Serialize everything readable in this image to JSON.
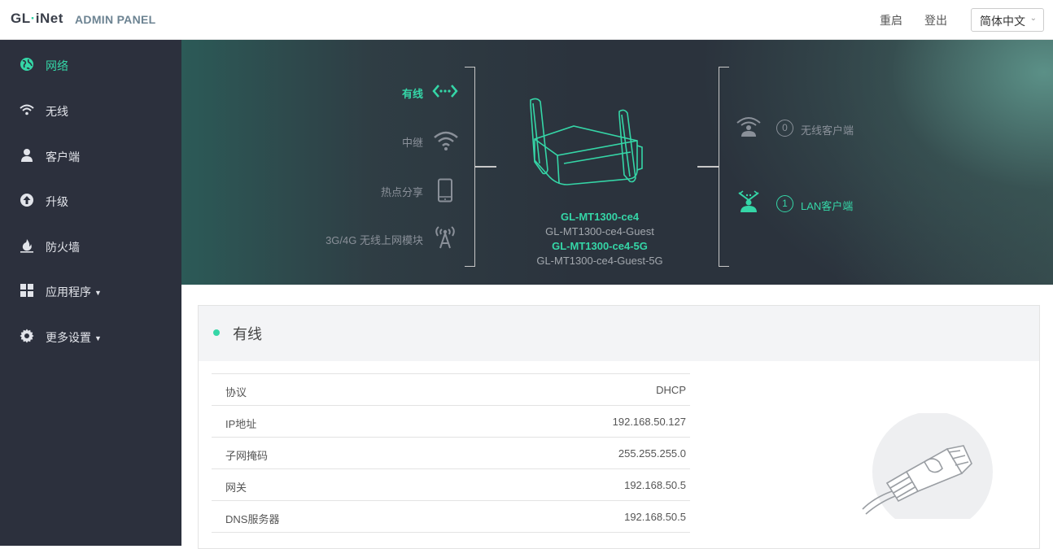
{
  "header": {
    "logo": {
      "part1": "GL",
      "dot": "·",
      "part2": "iNet"
    },
    "panel_title": "ADMIN PANEL",
    "reboot": "重启",
    "logout": "登出",
    "language": "简体中文"
  },
  "sidebar": {
    "items": [
      {
        "label": "网络",
        "icon": "globe-icon",
        "active": true
      },
      {
        "label": "无线",
        "icon": "wifi-icon"
      },
      {
        "label": "客户端",
        "icon": "user-icon"
      },
      {
        "label": "升级",
        "icon": "upgrade-icon"
      },
      {
        "label": "防火墙",
        "icon": "fire-icon"
      },
      {
        "label": "应用程序",
        "icon": "apps-grid-icon",
        "has_dropdown": true
      },
      {
        "label": "更多设置",
        "icon": "gear-icon",
        "has_dropdown": true
      }
    ]
  },
  "hero": {
    "connections": [
      {
        "label": "有线",
        "icon": "ethernet-arrows-icon",
        "active": true
      },
      {
        "label": "中继",
        "icon": "wifi-repeater-icon"
      },
      {
        "label": "热点分享",
        "icon": "phone-tethering-icon"
      },
      {
        "label": "3G/4G 无线上网模块",
        "icon": "cellular-tower-icon"
      }
    ],
    "ssids": [
      {
        "name": "GL-MT1300-ce4",
        "bright": true
      },
      {
        "name": "GL-MT1300-ce4-Guest",
        "bright": false
      },
      {
        "name": "GL-MT1300-ce4-5G",
        "bright": true
      },
      {
        "name": "GL-MT1300-ce4-Guest-5G",
        "bright": false
      }
    ],
    "clients": [
      {
        "count": "0",
        "label": "无线客户端",
        "icon": "wireless-client-icon",
        "active": false
      },
      {
        "count": "1",
        "label": "LAN客户端",
        "icon": "lan-client-icon",
        "active": true
      }
    ]
  },
  "card": {
    "title": "有线",
    "rows": [
      {
        "key": "协议",
        "value": "DHCP"
      },
      {
        "key": "IP地址",
        "value": "192.168.50.127"
      },
      {
        "key": "子网掩码",
        "value": "255.255.255.0"
      },
      {
        "key": "网关",
        "value": "192.168.50.5"
      },
      {
        "key": "DNS服务器",
        "value": "192.168.50.5"
      }
    ]
  },
  "colors": {
    "accent": "#35d6a7",
    "sidebar_bg": "#2c303d",
    "hero_bg": "#2b333d"
  }
}
